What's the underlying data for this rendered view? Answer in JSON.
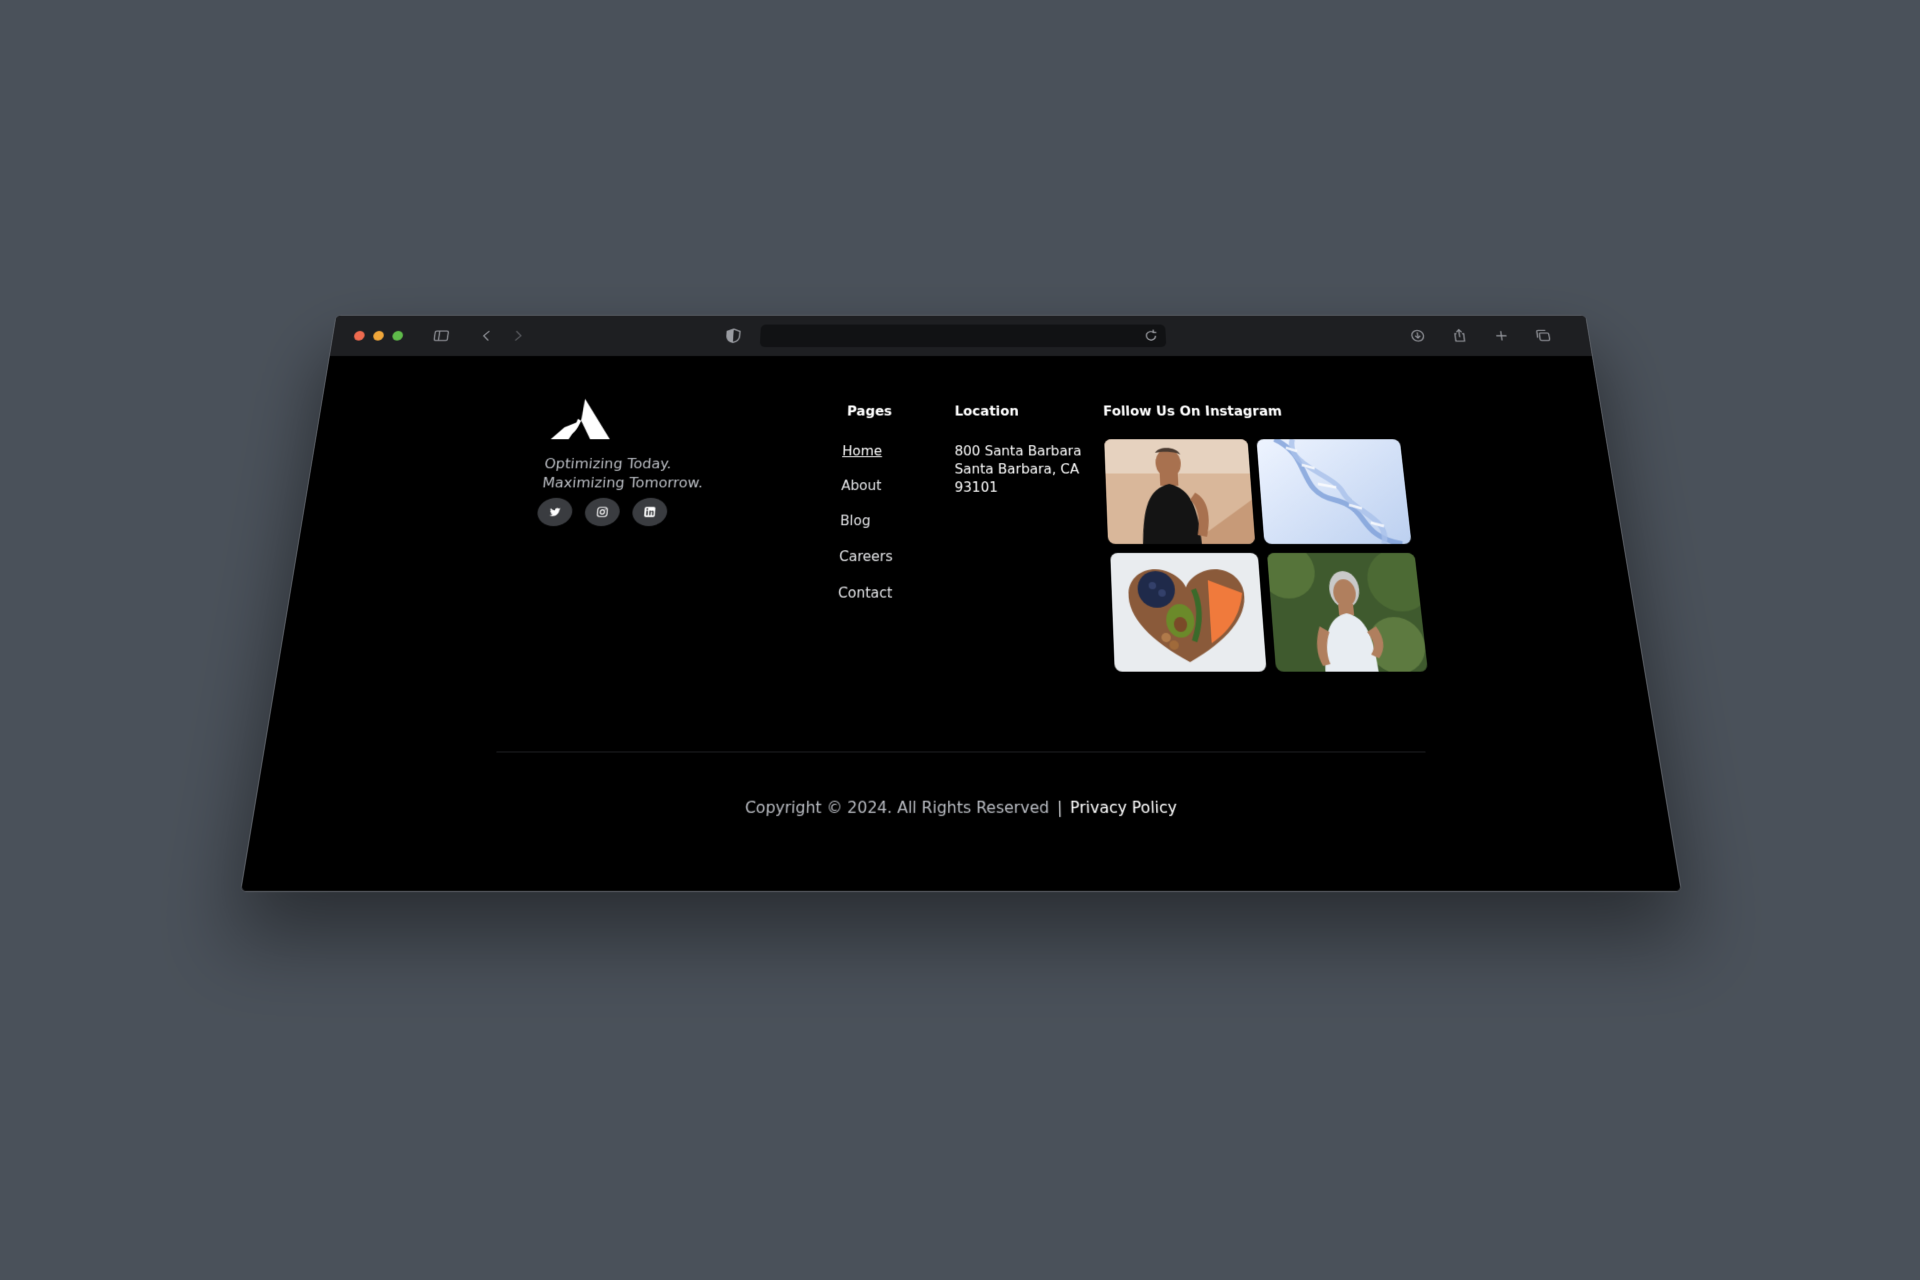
{
  "browser": {
    "url": "",
    "icons": [
      "sidebar-icon",
      "back-icon",
      "forward-icon",
      "privacy-shield-icon",
      "reload-icon",
      "download-icon",
      "share-icon",
      "new-tab-icon",
      "tabs-overview-icon"
    ]
  },
  "brand": {
    "tagline_line1": "Optimizing Today.",
    "tagline_line2": "Maximizing Tomorrow.",
    "socials": [
      "twitter-icon",
      "instagram-icon",
      "linkedin-icon"
    ]
  },
  "pages": {
    "title": "Pages",
    "items": [
      {
        "label": "Home",
        "active": true
      },
      {
        "label": "About",
        "active": false
      },
      {
        "label": "Blog",
        "active": false
      },
      {
        "label": "Careers",
        "active": false
      },
      {
        "label": "Contact",
        "active": false
      }
    ]
  },
  "location": {
    "title": "Location",
    "line1": "800 Santa Barbara",
    "line2": "Santa Barbara, CA",
    "line3": "93101"
  },
  "instagram": {
    "title": "Follow Us On Instagram"
  },
  "footer": {
    "copyright": "Copyright © 2024. All Rights Reserved",
    "separator": "|",
    "privacy": "Privacy Policy"
  },
  "colors": {
    "background": "#000000",
    "desk": "#4a515a",
    "toolbar": "#1e1f22",
    "social_bg": "#3a3c40"
  }
}
